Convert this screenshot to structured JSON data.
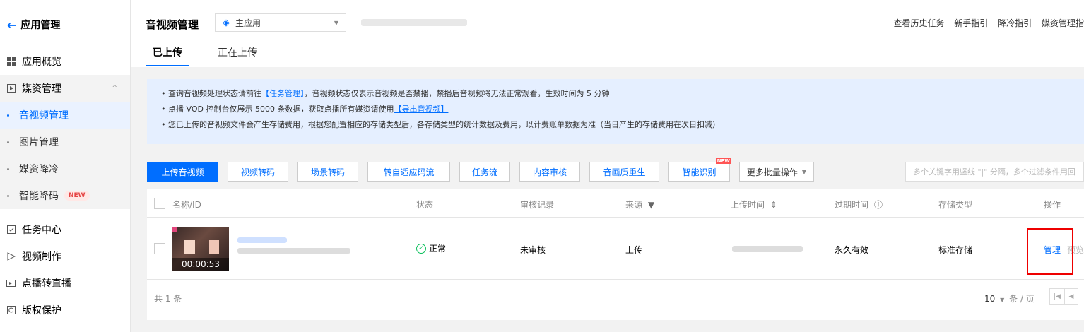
{
  "sidebar": {
    "back_label": "应用管理",
    "items": [
      {
        "label": "应用概览"
      },
      {
        "label": "媒资管理"
      },
      {
        "label": "任务中心"
      },
      {
        "label": "视频制作"
      },
      {
        "label": "点播转直播"
      },
      {
        "label": "版权保护"
      }
    ],
    "sub_items": [
      {
        "label": "音视频管理"
      },
      {
        "label": "图片管理"
      },
      {
        "label": "媒资降冷"
      },
      {
        "label": "智能降码"
      }
    ],
    "new_badge": "NEW"
  },
  "header": {
    "title": "音视频管理",
    "app_select": "主应用",
    "links": [
      "查看历史任务",
      "新手指引",
      "降冷指引",
      "媒资管理指"
    ],
    "tabs": [
      "已上传",
      "正在上传"
    ]
  },
  "notice": {
    "line1_prefix": "查询音视频处理状态请前往",
    "line1_link": "【任务管理】",
    "line1_suffix": "，音视频状态仅表示音视频是否禁播，禁播后音视频将无法正常观看，生效时间为 5 分钟",
    "line2_prefix": "点播 VOD 控制台仅展示 5000 条数据，获取点播所有媒资请使用",
    "line2_link": "【导出音视频】",
    "line3": "您已上传的音视频文件会产生存储费用，根据您配置相应的存储类型后，各存储类型的统计数据及费用，以计费账单数据为准（当日产生的存储费用在次日扣减）"
  },
  "toolbar": {
    "buttons": [
      "上传音视频",
      "视频转码",
      "场景转码",
      "转自适应码流",
      "任务流",
      "内容审核",
      "音画质重生",
      "智能识别",
      "更多批量操作"
    ],
    "new_tag": "NEW",
    "search_placeholder": "多个关键字用竖线 \"|\" 分隔，多个过滤条件用回"
  },
  "table": {
    "columns": [
      "名称/ID",
      "状态",
      "审核记录",
      "来源",
      "上传时间",
      "过期时间",
      "存储类型",
      "操作"
    ],
    "rows": [
      {
        "duration": "00:00:53",
        "status": "正常",
        "review": "未审核",
        "source": "上传",
        "expire": "永久有效",
        "storage": "标准存储",
        "op_manage": "管理",
        "op_preview": "预览"
      }
    ],
    "total": "共 1 条",
    "page_size": "10",
    "page_unit": "条 / 页"
  }
}
